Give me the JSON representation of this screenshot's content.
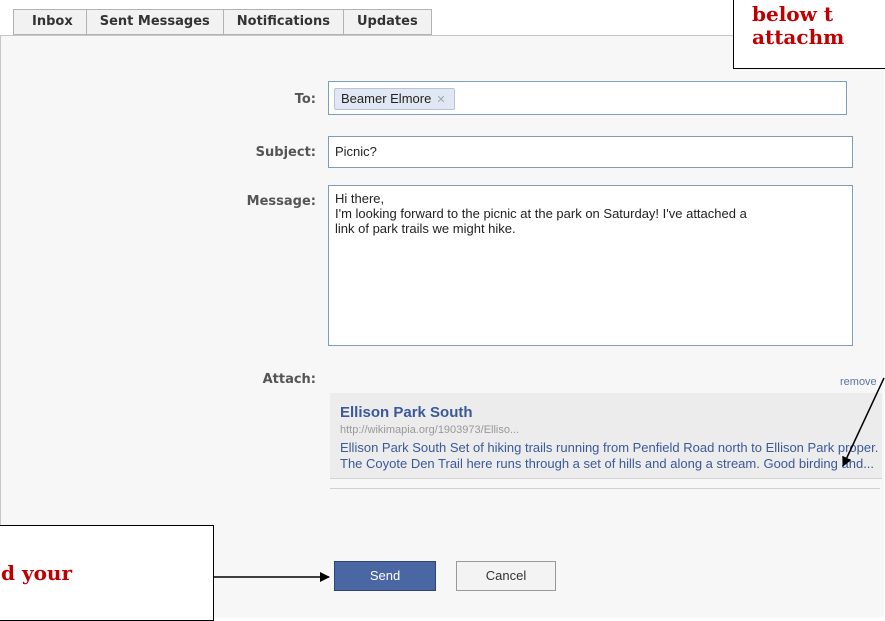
{
  "tabs": [
    "Inbox",
    "Sent Messages",
    "Notifications",
    "Updates"
  ],
  "compose": {
    "to_label": "To:",
    "to_recipient": "Beamer Elmore",
    "remove_recipient_icon": "close-icon",
    "subject_label": "Subject:",
    "subject_value": "Picnic?",
    "message_label": "Message:",
    "message_value": "Hi there,\nI'm looking forward to the picnic at the park on Saturday! I've attached a\nlink of park trails we might hike.",
    "attach_label": "Attach:",
    "remove_link": "remove"
  },
  "attachment": {
    "title": "Ellison Park South",
    "url": "http://wikimapia.org/1903973/Elliso...",
    "description": "Ellison Park South Set of hiking trails running from Penfield Road north to Ellison Park proper. The Coyote Den Trail here runs through a set of hills and along a stream. Good birding and..."
  },
  "buttons": {
    "send": "Send",
    "cancel": "Cancel"
  },
  "callouts": {
    "top_line1": "below t",
    "top_line2": "attachm",
    "bottom_line1": "d your"
  },
  "colors": {
    "link_blue": "#3b5998",
    "send_button": "#4a67a3",
    "callout_text": "#c00000"
  }
}
